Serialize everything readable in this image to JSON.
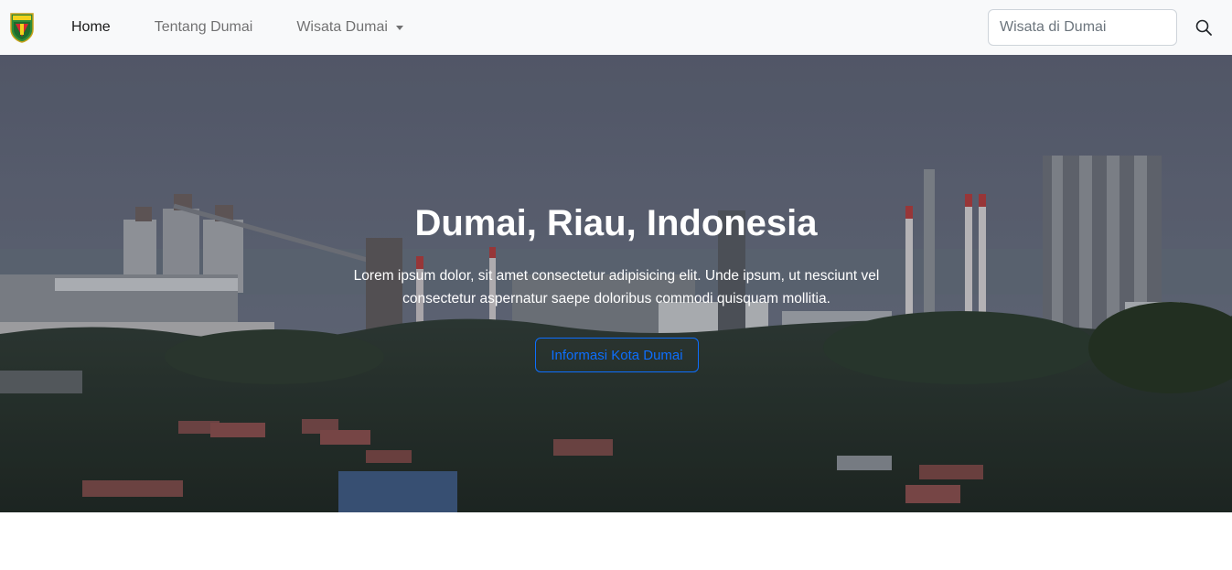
{
  "navbar": {
    "logo_icon": "dumai-crest-logo",
    "links": [
      {
        "label": "Home",
        "active": true
      },
      {
        "label": "Tentang Dumai",
        "active": false
      },
      {
        "label": "Wisata Dumai",
        "active": false,
        "dropdown": true
      }
    ],
    "search": {
      "placeholder": "Wisata di Dumai",
      "icon": "search-icon"
    }
  },
  "hero": {
    "title": "Dumai, Riau, Indonesia",
    "text": "Lorem ipsum dolor, sit amet consectetur adipisicing elit. Unde ipsum, ut nesciunt vel consectetur aspernatur saepe doloribus commodi quisquam mollitia.",
    "button_label": "Informasi Kota Dumai",
    "background": "industrial refinery skyline above a town"
  },
  "colors": {
    "navbar_bg": "#f8f9fa",
    "accent": "#0d6efd",
    "hero_text": "#ffffff"
  }
}
